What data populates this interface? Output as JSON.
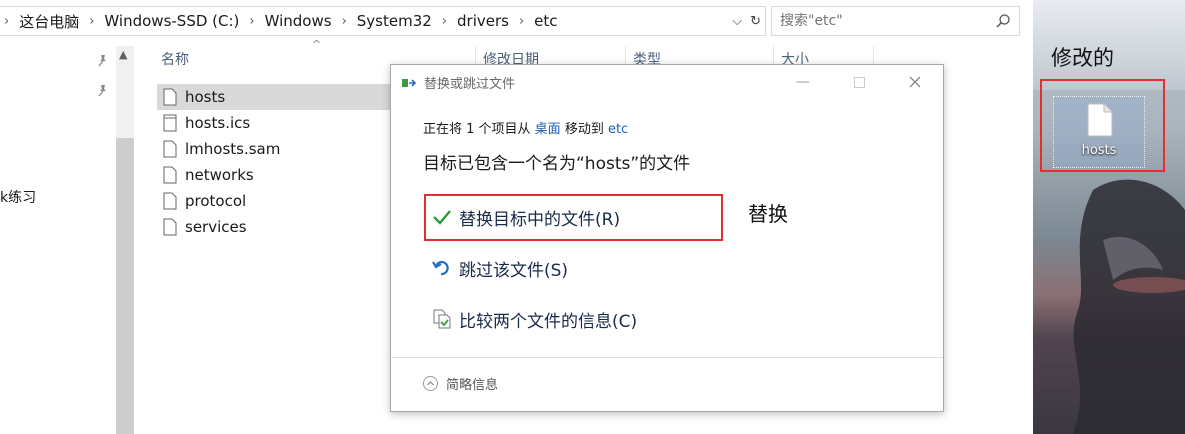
{
  "address": {
    "crumbs": [
      "这台电脑",
      "Windows-SSD (C:)",
      "Windows",
      "System32",
      "drivers",
      "etc"
    ]
  },
  "search": {
    "placeholder": "搜索\"etc\""
  },
  "nav": {
    "partial_item": "k练习"
  },
  "columns": {
    "name": "名称",
    "date": "修改日期",
    "type": "类型",
    "size": "大小"
  },
  "files": [
    {
      "name": "hosts",
      "selected": true
    },
    {
      "name": "hosts.ics"
    },
    {
      "name": "lmhosts.sam"
    },
    {
      "name": "networks"
    },
    {
      "name": "protocol"
    },
    {
      "name": "services"
    }
  ],
  "dialog": {
    "title": "替换或跳过文件",
    "status_prefix": "正在将 1 个项目从 ",
    "status_source": "桌面",
    "status_middle": " 移动到 ",
    "status_dest": "etc",
    "heading": "目标已包含一个名为“hosts”的文件",
    "options": [
      {
        "label": "替换目标中的文件(R)",
        "icon": "check-icon"
      },
      {
        "label": "跳过该文件(S)",
        "icon": "skip-arrow-icon"
      },
      {
        "label": "比较两个文件的信息(C)",
        "icon": "compare-icon"
      }
    ],
    "details": "简略信息"
  },
  "annotations": {
    "replace_note": "替换",
    "modified_note": "修改的"
  },
  "desktop": {
    "icon_label": "hosts"
  },
  "colors": {
    "accent_link": "#1a5fb4",
    "annotation_red": "#e03030",
    "check_green": "#2f9a3a"
  }
}
